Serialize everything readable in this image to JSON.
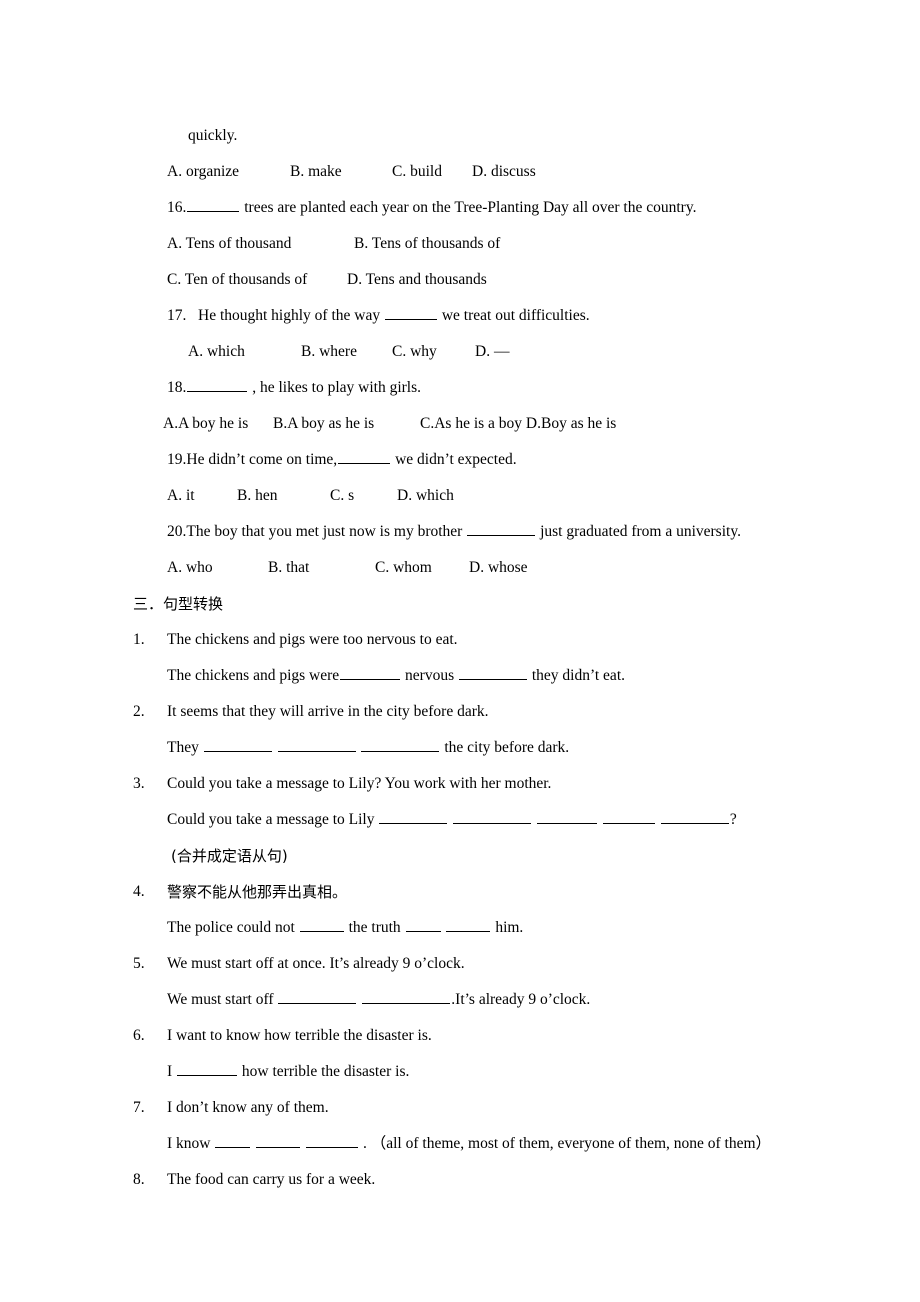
{
  "document": {
    "page_background": "#ffffff",
    "text_color": "#000000"
  },
  "multiple_choice": {
    "q15_continuation": "quickly.",
    "q15_options": [
      {
        "label": "A. organize"
      },
      {
        "label": "B. make"
      },
      {
        "label": "C. build"
      },
      {
        "label": "D. discuss"
      }
    ],
    "q16": {
      "number": "16.",
      "text_before_blank": "",
      "text_after_blank": "trees are planted each year on the Tree-Planting Day all over the country.",
      "options_row1": [
        {
          "label": "A. Tens of thousand"
        },
        {
          "label": "B. Tens of thousands of"
        }
      ],
      "options_row2": [
        {
          "label": "C. Ten of thousands of"
        },
        {
          "label": "D. Tens and thousands"
        }
      ]
    },
    "q17": {
      "number": "17.",
      "text_before_blank": "He thought highly of the way",
      "text_after_blank": "we treat out difficulties.",
      "options": [
        {
          "label": "A. which"
        },
        {
          "label": "B. where"
        },
        {
          "label": "C. why"
        },
        {
          "label": "D.",
          "glyph": "—"
        }
      ]
    },
    "q18": {
      "number": "18.",
      "text_after_blank": ", he likes to play with girls.",
      "options_inline": [
        {
          "label": "A.A boy he is"
        },
        {
          "label": "B.A boy as he is"
        },
        {
          "label": "C.As he is a boy D.Boy as he is"
        }
      ]
    },
    "q19": {
      "number": "19.",
      "text_before_blank": "He didn’t come on time,",
      "text_after_blank": "we didn’t expected.",
      "options": [
        {
          "label": "A. it"
        },
        {
          "label": "B. hen"
        },
        {
          "label": "C. s"
        },
        {
          "label": "D. which"
        }
      ]
    },
    "q20": {
      "number": "20.",
      "text_before_blank": "The boy that you met just now is my brother",
      "text_after_blank": "just graduated from a university.",
      "options": [
        {
          "label": "A. who"
        },
        {
          "label": "B. that"
        },
        {
          "label": "C. whom"
        },
        {
          "label": "D. whose"
        }
      ]
    }
  },
  "section_three": {
    "heading": "三．句型转换",
    "items": [
      {
        "number": "1.",
        "prompt": "The chickens and pigs were too nervous to eat.",
        "answer_prefix": "The chickens and pigs were",
        "answer_mid": "nervous",
        "answer_suffix": "they didn’t eat."
      },
      {
        "number": "2.",
        "prompt": "It seems that they will arrive in the city before dark.",
        "answer_prefix": "They",
        "answer_suffix": "the city before dark."
      },
      {
        "number": "3.",
        "prompt": "Could you take a message to Lily? You work with her mother.",
        "answer_prefix": "Could you take a message to Lily",
        "answer_suffix": "?",
        "note": "(合并成定语从句)"
      },
      {
        "number": "4.",
        "prompt": "警察不能从他那弄出真相。",
        "answer_prefix": "The police could not",
        "answer_mid": "the truth",
        "answer_suffix": "him."
      },
      {
        "number": "5.",
        "prompt": "We must start off at once. It’s already 9 o’clock.",
        "answer_prefix": "We must start off",
        "answer_suffix": ".It’s already 9 o’clock."
      },
      {
        "number": "6.",
        "prompt": "I want to know how terrible the disaster is.",
        "answer_prefix": "I",
        "answer_suffix": "how terrible the disaster is."
      },
      {
        "number": "7.",
        "prompt": "I don’t know any of them.",
        "answer_prefix": "I know",
        "answer_suffix": ".",
        "word_bank": "（all of theme, most of them, everyone of them, none of them）"
      },
      {
        "number": "8.",
        "prompt": "The food can carry us for a week."
      }
    ]
  }
}
